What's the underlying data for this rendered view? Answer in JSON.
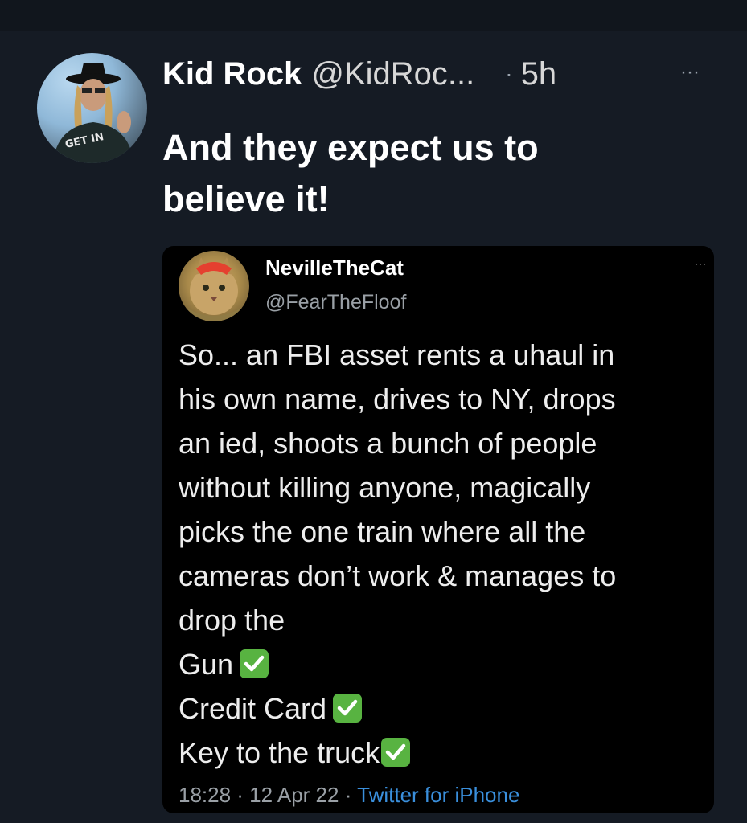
{
  "tweet": {
    "author_name": "Kid Rock",
    "author_handle": "@KidRoc...",
    "separator": "·",
    "time": "5h",
    "more_label": "···",
    "text_lines": [
      "And they expect us to",
      "believe it!"
    ],
    "avatar_icon": "kid-rock-avatar"
  },
  "quoted": {
    "author_name": "NevilleTheCat",
    "author_handle": "@FearTheFloof",
    "avatar_icon": "cat-avatar",
    "text_lines": [
      "So... an FBI asset rents a uhaul in",
      "his own name, drives to NY, drops",
      "an ied, shoots a bunch of people",
      "without killing anyone, magically",
      "picks the one train where all the",
      "cameras don’t work & manages to",
      "drop the"
    ],
    "checklist": [
      "Gun",
      "Credit Card",
      "Key to the truck"
    ],
    "check_icon": "check-mark-button-emoji",
    "meta_time": "18:28 · 12 Apr 22 · ",
    "meta_source": "Twitter for iPhone",
    "more_label": "⋮"
  },
  "colors": {
    "background": "#151b24",
    "link": "#3a8fdc",
    "check": "#58b341"
  }
}
